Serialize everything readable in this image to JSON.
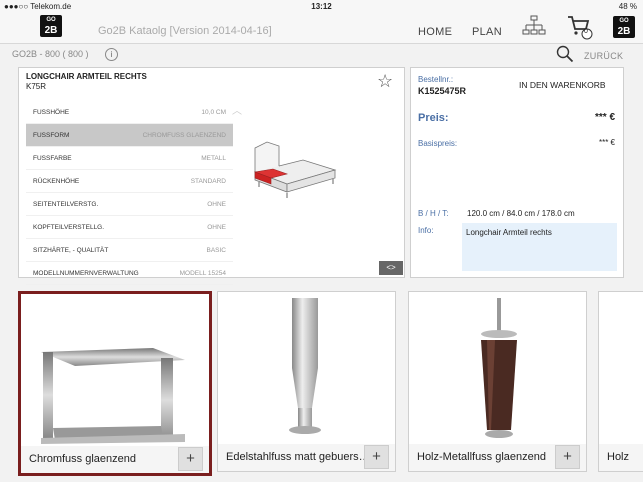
{
  "status_bar": {
    "carrier": "●●●○○ Telekom.de",
    "time": "13:12",
    "battery": "48 %"
  },
  "header": {
    "title": "Go2B Kataolg  [Version 2014-04-16]",
    "nav": {
      "home": "HOME",
      "plan": "PLAN"
    },
    "cart_count": "0",
    "logo_top": "GO",
    "logo_bottom": "2B"
  },
  "subheader": {
    "catalog": "GO2B - 800 ( 800 )",
    "info": "i",
    "back": "ZURÜCK"
  },
  "product": {
    "title": "LONGCHAIR ARMTEIL RECHTS",
    "code": "K75R",
    "properties": [
      {
        "key": "FUSSHÖHE",
        "value": "10,0 CM"
      },
      {
        "key": "FUSSFORM",
        "value": "CHROMFUSS GLAENZEND"
      },
      {
        "key": "FUSSFARBE",
        "value": "METALL"
      },
      {
        "key": "RÜCKENHÖHE",
        "value": "STANDARD"
      },
      {
        "key": "SEITENTEILVERSTG.",
        "value": "OHNE"
      },
      {
        "key": "KOPFTEILVERSTELLG.",
        "value": "OHNE"
      },
      {
        "key": "SITZHÄRTE, - QUALITÄT",
        "value": "BASIC"
      },
      {
        "key": "MODELLNUMMERNVERWALTUNG",
        "value": "MODELL 15254"
      }
    ],
    "swap_label": "<>"
  },
  "order": {
    "order_label": "Bestellnr.:",
    "order_number": "K1525475R",
    "cart_button": "IN DEN WARENKORB",
    "price_label": "Preis:",
    "price_value": "*** €",
    "base_price_label": "Basispreis:",
    "base_price_value": "*** €",
    "dims_label": "B / H / T:",
    "dims_value": "120.0 cm / 84.0 cm / 178.0 cm",
    "info_label": "Info:",
    "info_value": "Longchair Armteil rechts"
  },
  "cards": [
    {
      "label": "Chromfuss glaenzend",
      "plus": "+"
    },
    {
      "label": "Edelstahlfuss matt gebuers…",
      "plus": "+"
    },
    {
      "label": "Holz-Metallfuss glaenzend",
      "plus": "+"
    },
    {
      "label": "Holz",
      "plus": "+"
    }
  ],
  "colors": {
    "selected_border": "#7a1e1e",
    "accent_blue": "#4a6fa5",
    "selected_row": "#c8c8c8"
  }
}
